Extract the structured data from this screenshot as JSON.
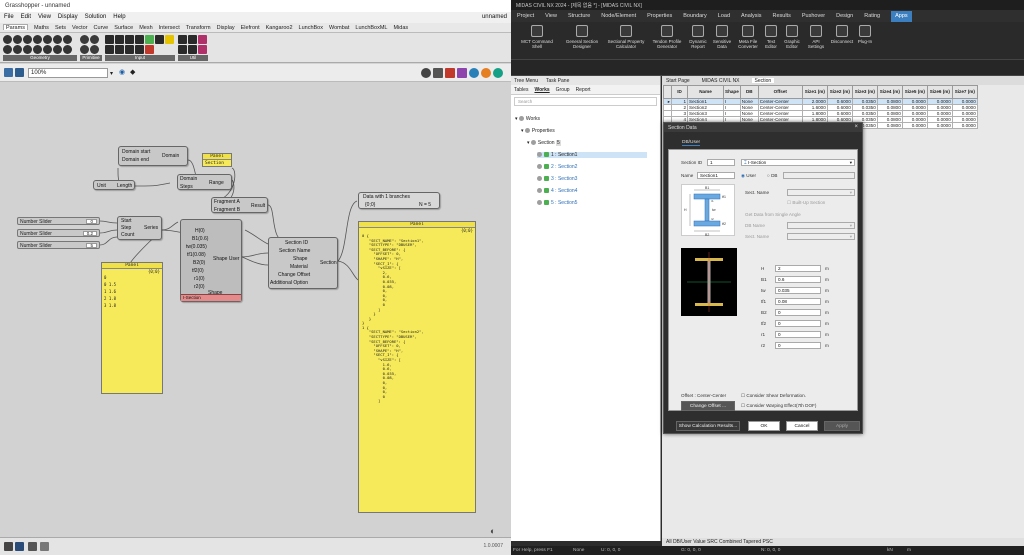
{
  "gh": {
    "title": "Grasshopper - unnamed",
    "menu": [
      "File",
      "Edit",
      "View",
      "Display",
      "Solution",
      "Help"
    ],
    "doc_name": "unnamed",
    "tabs": [
      "Params",
      "Maths",
      "Sets",
      "Vector",
      "Curve",
      "Surface",
      "Mesh",
      "Intersect",
      "Transform",
      "Display",
      "Elefront",
      "Kangaroo2",
      "LunchBox",
      "Wombat",
      "LunchBoxML",
      "Midas"
    ],
    "ribbon_groups": [
      "Geometry",
      "Primitive",
      "Input",
      "Util"
    ],
    "zoom": "100%",
    "status_version": "1.0.0007",
    "nodes": {
      "domain_start": "Domain start",
      "domain_end": "Domain end",
      "domain": "Domain",
      "range": "Range",
      "range_domain": "Domain",
      "range_steps": "Steps",
      "unit": "Unit",
      "length": "Length",
      "series_start": "Start",
      "series_step": "Step",
      "series_count": "Count",
      "series": "Series",
      "panel_small_title": "Panel",
      "panel_small_sub": "Section",
      "fragment_a": "Fragment A",
      "fragment_b": "Fragment B",
      "result": "Result",
      "shape_inputs": [
        "H(0)",
        "B1(0.6)",
        "tw(0.035)",
        "tf1(0.08)",
        "B2(0)",
        "tf2(0)",
        "r1(0)",
        "r2(0)"
      ],
      "shape_user": "Shape User",
      "shape_footer": "I-Section",
      "shape_name": "Shape",
      "section_inputs": [
        "Section ID",
        "Section Name",
        "Shape",
        "Material",
        "Change Offset",
        "Additional Option"
      ],
      "section_out": "Section",
      "data_label": "Data with 1 branches",
      "data_path": "{0;0}",
      "data_count": "N = 5"
    },
    "sliders": [
      {
        "name": "Number Slider",
        "value": "0"
      },
      {
        "name": "Number Slider",
        "value": "0.2"
      },
      {
        "name": "Number Slider",
        "value": "5"
      }
    ],
    "panel_left": {
      "title": "Panel",
      "path": "{0;0}",
      "rows": [
        "0",
        "0 1.5",
        "1 1.6",
        "2 1.8",
        "3 1.8"
      ]
    },
    "panel_big": {
      "title": "Panel",
      "path": "{0;0}",
      "text": "0 {\n   \"SECT_NAME\": \"Section1\",\n   \"SECTTYPE\": \"DBUSER\",\n   \"SECT_BEFORE\": {\n     \"OFFSET\": 0,\n     \"SHAPE\": \"H\",\n     \"SECT_I\": {\n       \"vSIZE\": [\n         2,\n         0.6,\n         0.035,\n         0.08,\n         0,\n         0,\n         0,\n         0\n       ]\n     }\n   }\n}\n1 {\n   \"SECT_NAME\": \"Section2\",\n   \"SECTTYPE\": \"DBUSER\",\n   \"SECT_BEFORE\": {\n     \"OFFSET\": 0,\n     \"SHAPE\": \"H\",\n     \"SECT_I\": {\n       \"vSIZE\": [\n         1.6,\n         0.6,\n         0.035,\n         0.08,\n         0,\n         0,\n         0,\n         0\n       ]"
    }
  },
  "md": {
    "title": "MIDAS CIVIL NX 2024 - [제목 없음 *] - [MIDAS CIVIL NX]",
    "menu": [
      "Project",
      "View",
      "Structure",
      "Node/Element",
      "Properties",
      "Boundary",
      "Load",
      "Analysis",
      "Results",
      "Pushover",
      "Design",
      "Rating",
      "Apps"
    ],
    "menu_active": "Apps",
    "ribbon": [
      "MCT Command Shell",
      "General Section Designer",
      "Sectional Property Calculator",
      "Tendon Profile Generator",
      "Dynamic Report",
      "Sensitive Data",
      "Meta File Converter",
      "Text Editor",
      "Graphic Editor",
      "API Settings",
      "Disconnect",
      "Plug-In"
    ],
    "tree_header": [
      "Tree Menu",
      "Task Pane"
    ],
    "tree_tabs": [
      "Tables",
      "Works",
      "Group",
      "Report"
    ],
    "tree_tab_active": "Works",
    "search_placeholder": "Search",
    "tree": {
      "works": "Works",
      "properties": "Properties",
      "section": "Section",
      "section_count": "5",
      "items": [
        "1 : Section1",
        "2 : Section2",
        "3 : Section3",
        "4 : Section4",
        "5 : Section5"
      ]
    },
    "work_tabs": [
      "Start Page",
      "MIDAS CIVIL NX",
      "Section"
    ],
    "table": {
      "headers": [
        "ID",
        "Name",
        "Shape",
        "DB",
        "Offset",
        "Size1 (m)",
        "Size2 (m)",
        "Size3 (m)",
        "Size4 (m)",
        "Size5 (m)",
        "Size6 (m)",
        "Size7 (m)"
      ],
      "rows": [
        [
          "1",
          "Section1",
          "I",
          "None",
          "Center-Center",
          "2.0000",
          "0.6000",
          "0.0350",
          "0.0800",
          "0.0000",
          "0.0000",
          "0.0000"
        ],
        [
          "2",
          "Section2",
          "I",
          "None",
          "Center-Center",
          "1.6000",
          "0.6000",
          "0.0350",
          "0.0800",
          "0.0000",
          "0.0000",
          "0.0000"
        ],
        [
          "3",
          "Section3",
          "I",
          "None",
          "Center-Center",
          "1.8000",
          "0.6000",
          "0.0350",
          "0.0800",
          "0.0000",
          "0.0000",
          "0.0000"
        ],
        [
          "4",
          "Section4",
          "I",
          "None",
          "Center-Center",
          "1.8000",
          "0.6000",
          "0.0350",
          "0.0800",
          "0.0000",
          "0.0000",
          "0.0000"
        ],
        [
          "5",
          "Section5",
          "I",
          "None",
          "Center-Center",
          "2.0000",
          "0.6000",
          "0.0350",
          "0.0800",
          "0.0000",
          "0.0000",
          "0.0000"
        ]
      ]
    },
    "dialog": {
      "title": "Section Data",
      "tab": "DB/User",
      "section_id_label": "Section ID",
      "section_id": "1",
      "shape_select": "I-Section",
      "name_label": "Name",
      "name": "Section1",
      "radio_user": "User",
      "radio_db": "DB",
      "db_value": "",
      "sect_name_label": "Sect. Name",
      "built_up": "Built-Up Section",
      "get_data": "Get Data from Single Angle",
      "db_name_label": "DB Name",
      "sect_name2_label": "Sect. Name",
      "params": [
        {
          "label": "H",
          "value": "2",
          "unit": "m"
        },
        {
          "label": "B1",
          "value": "0.6",
          "unit": "m"
        },
        {
          "label": "tw",
          "value": "0.035",
          "unit": "m"
        },
        {
          "label": "tf1",
          "value": "0.08",
          "unit": "m"
        },
        {
          "label": "B2",
          "value": "0",
          "unit": "m"
        },
        {
          "label": "tf2",
          "value": "0",
          "unit": "m"
        },
        {
          "label": "r1",
          "value": "0",
          "unit": "m"
        },
        {
          "label": "r2",
          "value": "0",
          "unit": "m"
        }
      ],
      "offset_text": "Offset : Center-Center",
      "change_offset": "Change Offset ...",
      "shear_def": "Consider Shear Deformation.",
      "warping": "Consider Warping Effect(7th DOF)",
      "show_calc": "Show Calculation Results...",
      "ok": "OK",
      "cancel": "Cancel",
      "apply": "Apply"
    },
    "bottom_tabs": "All  DB/User  Value  SRC  Combined  Tapered  PSC",
    "status_left": "For Help, press F1",
    "status_none": "None",
    "status_u": "U: 0, 0, 0",
    "status_g": "G: 0, 0, 0",
    "status_n": "N: 0, 0, 0",
    "status_units": [
      "kN",
      "m"
    ]
  }
}
